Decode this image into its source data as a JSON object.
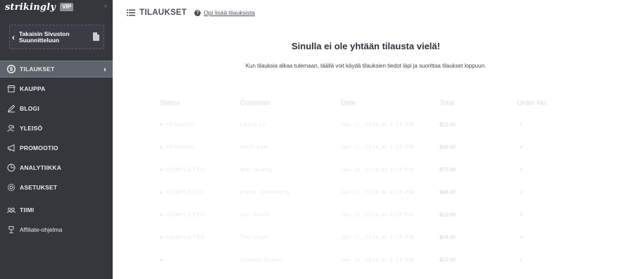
{
  "brand": {
    "logo": "strikingly",
    "badge": "VIP"
  },
  "sidebar": {
    "back_label_line1": "Takaisin Sivuston",
    "back_label_line2": "Suunnitteluun",
    "items": [
      {
        "label": "TILAUKSET",
        "icon": "dollar-circle-icon",
        "active": true
      },
      {
        "label": "KAUPPA",
        "icon": "store-icon"
      },
      {
        "label": "BLOGI",
        "icon": "pen-icon"
      },
      {
        "label": "YLEISÖ",
        "icon": "people-icon"
      },
      {
        "label": "PROMOOTIO",
        "icon": "megaphone-icon"
      },
      {
        "label": "ANALYTIIKKA",
        "icon": "pie-chart-icon"
      },
      {
        "label": "ASETUKSET",
        "icon": "gear-icon"
      },
      {
        "label": "TIIMI",
        "icon": "team-icon"
      },
      {
        "label": "Affiliate-ohjelma",
        "icon": "trophy-icon"
      }
    ]
  },
  "header": {
    "title": "TILAUKSET",
    "learn_link": "Opi lisää tilauksista"
  },
  "empty_state": {
    "title": "Sinulla ei ole yhtään tilausta vielä!",
    "subtitle": "Kun tilauksia alkaa tulemaan, täällä voit käydä tilauksien tiedot läpi ja suorittaa tilaukset loppuun."
  },
  "table": {
    "columns": [
      "Status",
      "Customer",
      "Date",
      "Total",
      "Order No."
    ],
    "rows": [
      {
        "status": "● PENDING",
        "customer": "Laura Lu",
        "date": "Jan 11, 2016 at 4:23 PM",
        "total": "$12.00",
        "order": "# ..."
      },
      {
        "status": "● PENDING",
        "customer": "Mark Lee",
        "date": "Jan 11, 2016 at 4:23 PM",
        "total": "$36.00",
        "order": "# ..."
      },
      {
        "status": "● COMPLETED",
        "customer": "Wei Huang",
        "date": "Jan 11, 2016 at 4:23 PM",
        "total": "$72.00",
        "order": "# ..."
      },
      {
        "status": "● COMPLETED",
        "customer": "Elena Smithberg",
        "date": "Jan 11, 2016 at 4:23 PM",
        "total": "$48.00",
        "order": "# ..."
      },
      {
        "status": "● COMPLETED",
        "customer": "Jon Smith",
        "date": "Jan 11, 2016 at 4:23 PM",
        "total": "$12.00",
        "order": "# ..."
      },
      {
        "status": "● COMPLETED",
        "customer": "Tim Chen",
        "date": "Jan 11, 2016 at 4:23 PM",
        "total": "$24.00",
        "order": "# ..."
      },
      {
        "status": "●",
        "customer": "Joanne Ruben",
        "date": "Jan 11, 2016 at 4:23 PM",
        "total": "$12.00",
        "order": "# ..."
      }
    ]
  },
  "colors": {
    "sidebar_bg": "#34383d",
    "active_item_bg": "#5f646b",
    "text_dark": "#2e3237"
  }
}
